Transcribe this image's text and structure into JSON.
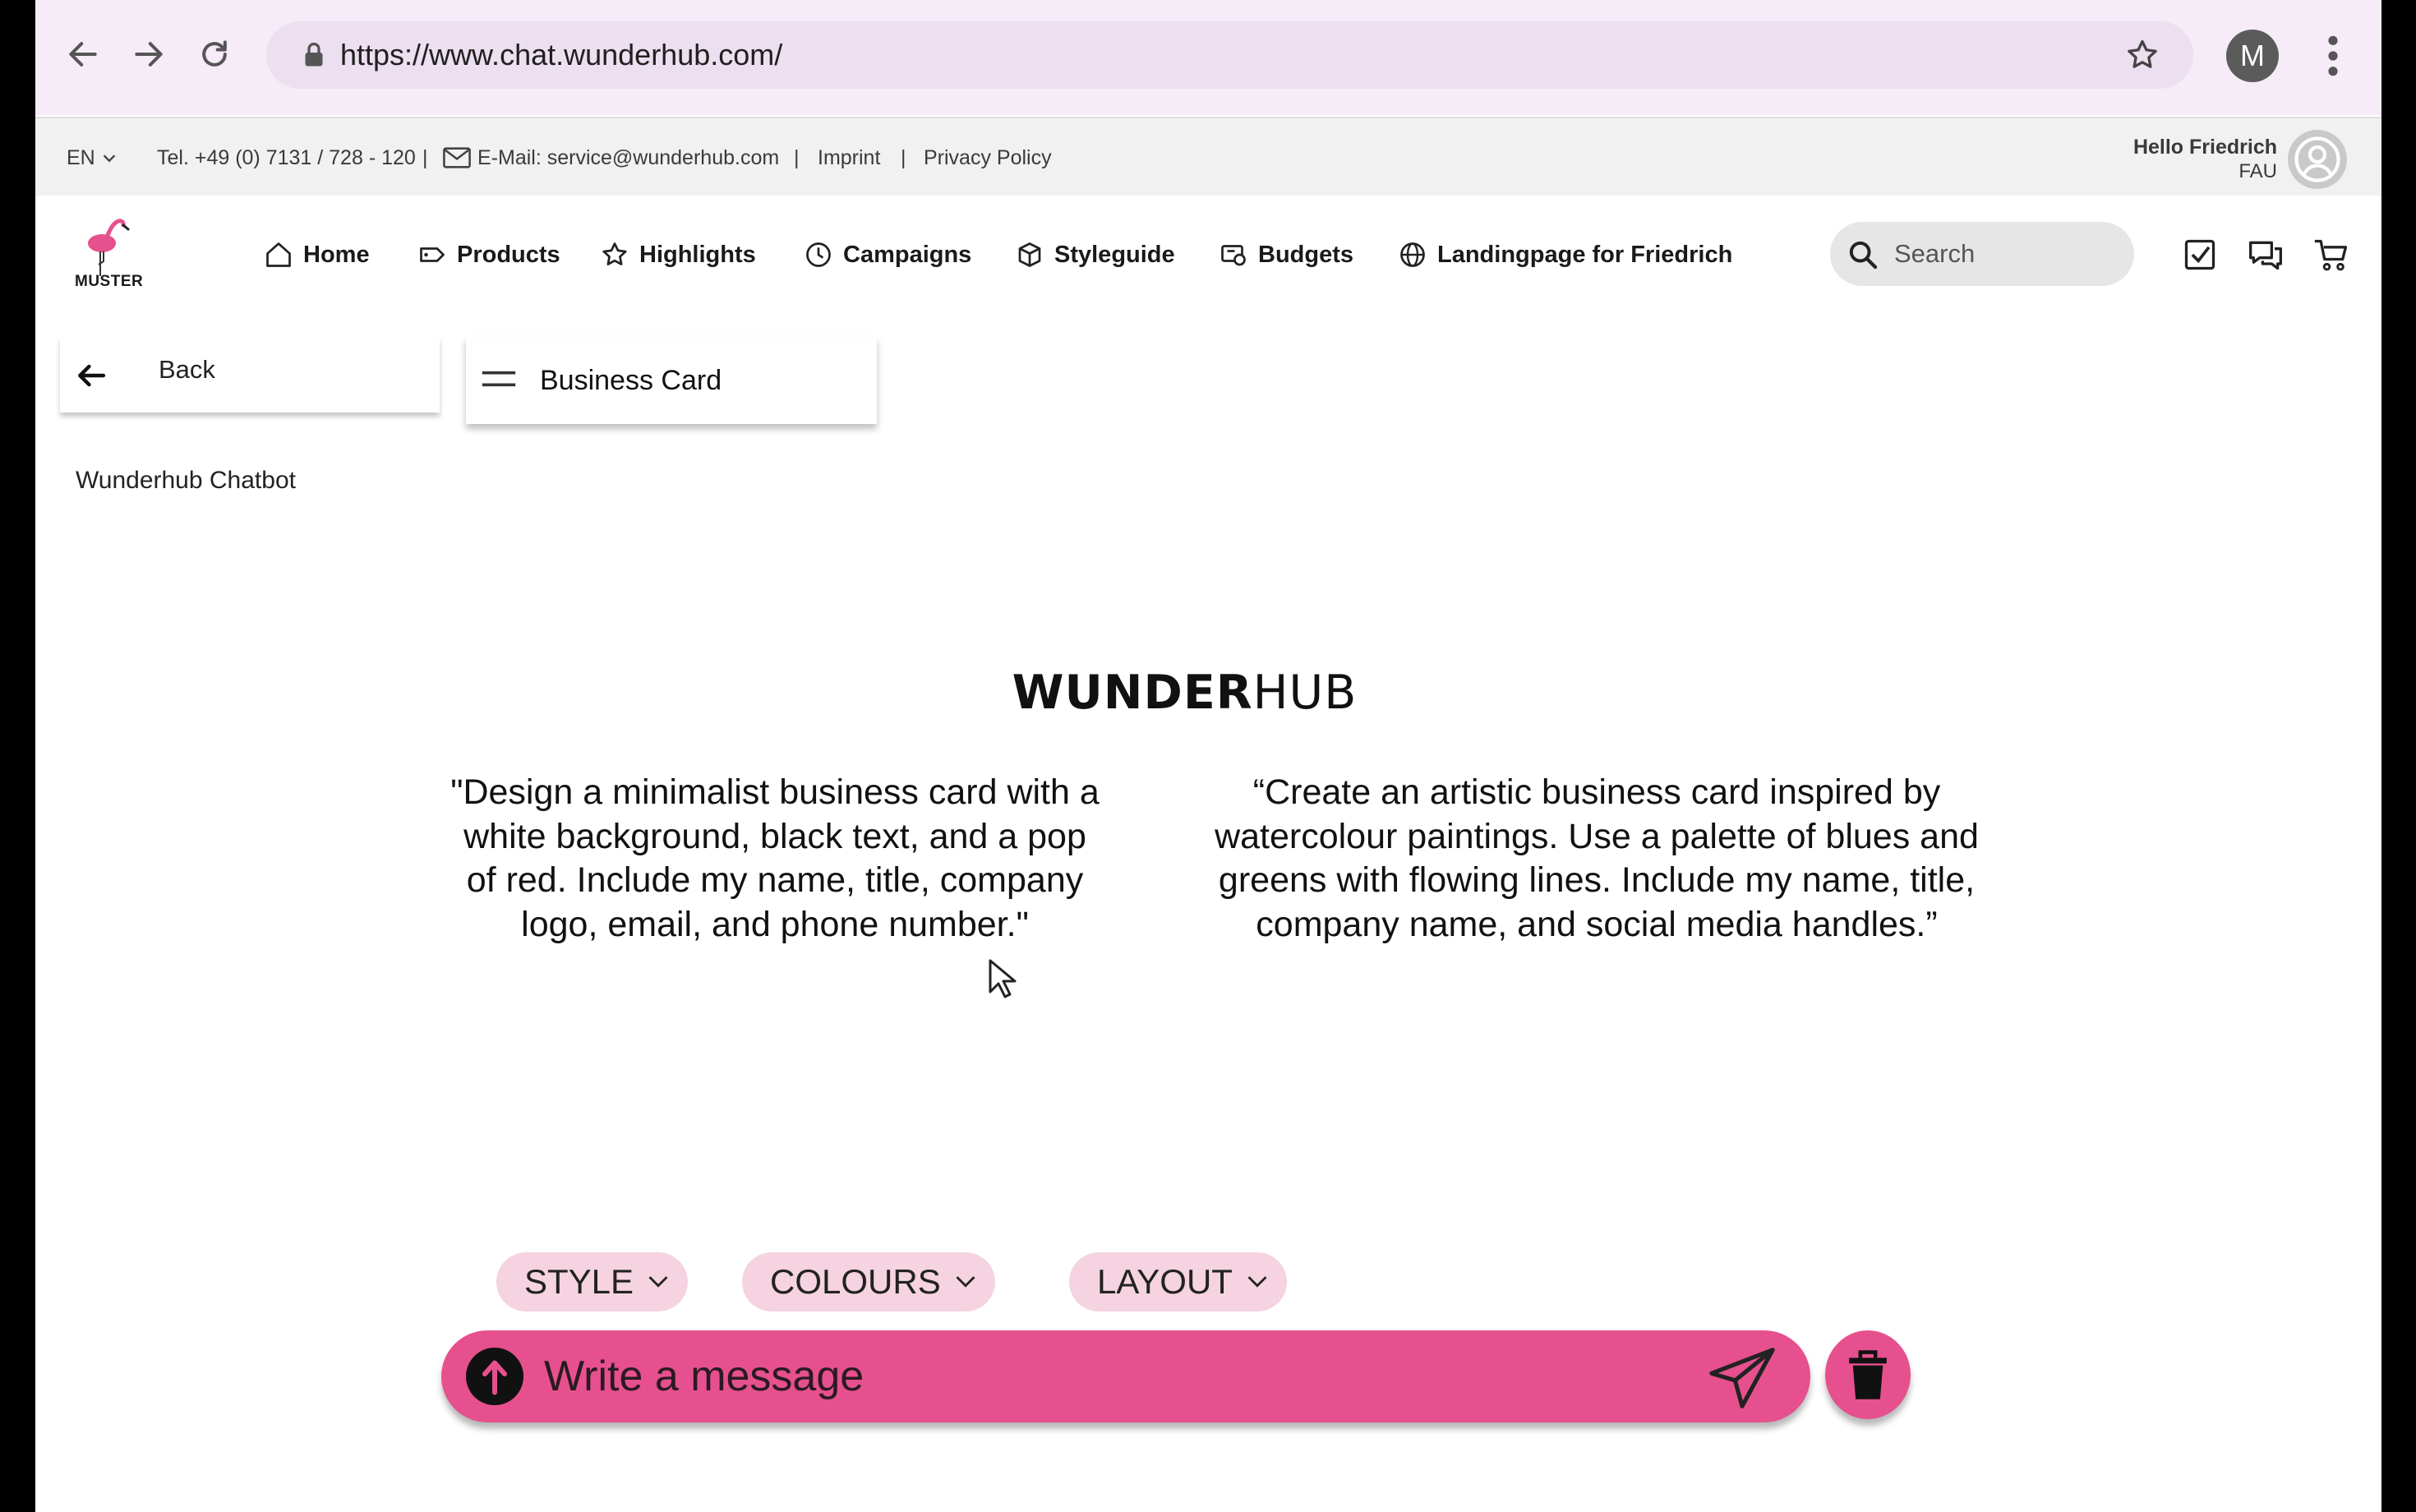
{
  "browser": {
    "url": "https://www.chat.wunderhub.com/",
    "profile_initial": "M"
  },
  "info_bar": {
    "language": "EN",
    "phone": "Tel. +49 (0) 7131 / 728 - 120",
    "sep": "|",
    "email": "E-Mail: service@wunderhub.com",
    "imprint": "Imprint",
    "privacy": "Privacy Policy",
    "greeting": "Hello Friedrich",
    "organization": "FAU"
  },
  "logo_text": "MUSTER",
  "nav": {
    "home": "Home",
    "products": "Products",
    "highlights": "Highlights",
    "campaigns": "Campaigns",
    "styleguide": "Styleguide",
    "budgets": "Budgets",
    "landingpage": "Landingpage for Friedrich"
  },
  "search": {
    "placeholder": "Search"
  },
  "back_label": "Back",
  "topic_label": "Business Card",
  "chatbot_title": "Wunderhub Chatbot",
  "brand": {
    "bold": "WUNDER",
    "light": "HUB"
  },
  "suggestions": [
    "\"Design a minimalist business card with a white background, black text, and a pop of red. Include my name, title, company logo, email, and phone number.\"",
    "“Create an artistic business card inspired by watercolour paintings. Use a palette of blues and greens with flowing lines. Include my name, title, company name, and social media handles.”"
  ],
  "chips": [
    "STYLE",
    "COLOURS",
    "LAYOUT"
  ],
  "composer": {
    "placeholder": "Write a message"
  },
  "colors": {
    "accent": "#e6508e",
    "chip": "#f5d3e0",
    "browser_bar": "#f6ecf8"
  }
}
